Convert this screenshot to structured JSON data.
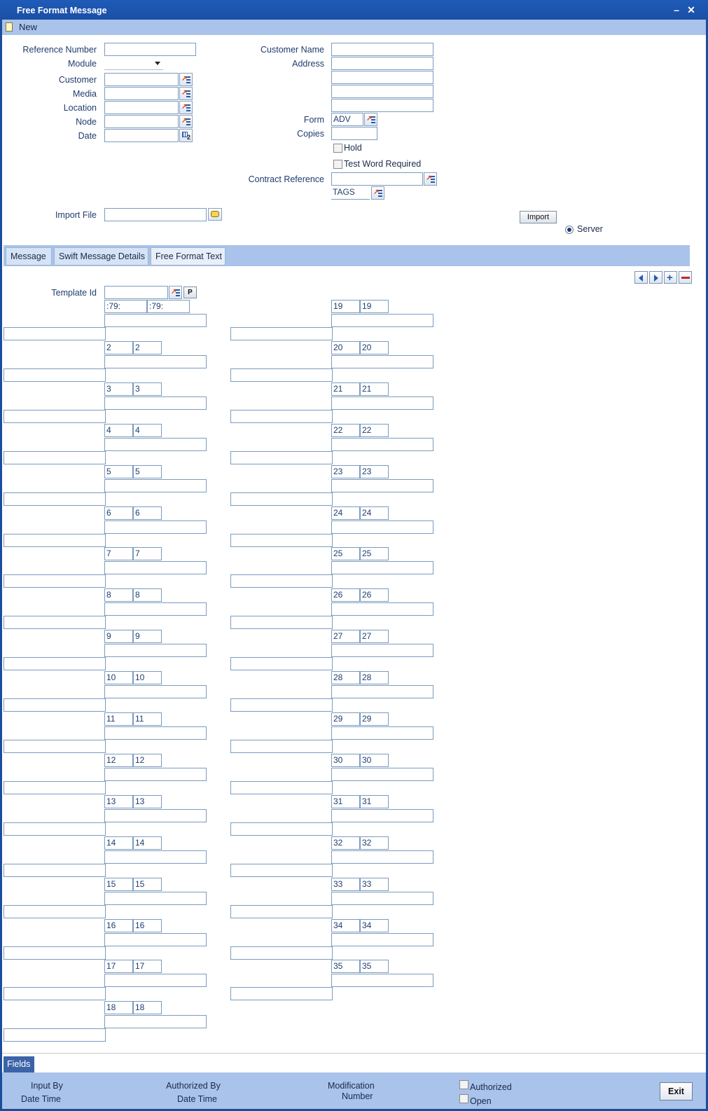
{
  "window": {
    "title": "Free Format Message",
    "minimize_icon": "minimize-icon",
    "close_icon": "close-icon"
  },
  "toolbar": {
    "new_label": "New"
  },
  "header": {
    "reference_number_label": "Reference Number",
    "module_label": "Module",
    "customer_label": "Customer",
    "media_label": "Media",
    "location_label": "Location",
    "node_label": "Node",
    "date_label": "Date",
    "date_icon_text": "2",
    "customer_name_label": "Customer Name",
    "address_label": "Address",
    "form_label": "Form",
    "form_value": "ADV",
    "copies_label": "Copies",
    "hold_label": "Hold",
    "test_word_label": "Test Word Required",
    "contract_reference_label": "Contract Reference",
    "tags_value": "TAGS",
    "import_file_label": "Import File",
    "import_button": "Import",
    "server_label": "Server"
  },
  "tabs": [
    {
      "label": "Message"
    },
    {
      "label": "Swift Message Details"
    },
    {
      "label": "Free Format Text"
    }
  ],
  "template": {
    "template_id_label": "Template Id",
    "p_button": "P"
  },
  "tag_rows_left": [
    [
      ":79:",
      ":79:"
    ],
    [
      "2",
      "2"
    ],
    [
      "3",
      "3"
    ],
    [
      "4",
      "4"
    ],
    [
      "5",
      "5"
    ],
    [
      "6",
      "6"
    ],
    [
      "7",
      "7"
    ],
    [
      "8",
      "8"
    ],
    [
      "9",
      "9"
    ],
    [
      "10",
      "10"
    ],
    [
      "11",
      "11"
    ],
    [
      "12",
      "12"
    ],
    [
      "13",
      "13"
    ],
    [
      "14",
      "14"
    ],
    [
      "15",
      "15"
    ],
    [
      "16",
      "16"
    ],
    [
      "17",
      "17"
    ],
    [
      "18",
      "18"
    ]
  ],
  "tag_rows_right": [
    [
      "19",
      "19"
    ],
    [
      "20",
      "20"
    ],
    [
      "21",
      "21"
    ],
    [
      "22",
      "22"
    ],
    [
      "23",
      "23"
    ],
    [
      "24",
      "24"
    ],
    [
      "25",
      "25"
    ],
    [
      "26",
      "26"
    ],
    [
      "27",
      "27"
    ],
    [
      "28",
      "28"
    ],
    [
      "29",
      "29"
    ],
    [
      "30",
      "30"
    ],
    [
      "31",
      "31"
    ],
    [
      "32",
      "32"
    ],
    [
      "33",
      "33"
    ],
    [
      "34",
      "34"
    ],
    [
      "35",
      "35"
    ]
  ],
  "fields_tab": "Fields",
  "footer": {
    "input_by": "Input By",
    "date_time_1": "Date Time",
    "authorized_by": "Authorized By",
    "date_time_2": "Date Time",
    "modification": "Modification",
    "number": "Number",
    "authorized": "Authorized",
    "open": "Open",
    "exit": "Exit"
  }
}
